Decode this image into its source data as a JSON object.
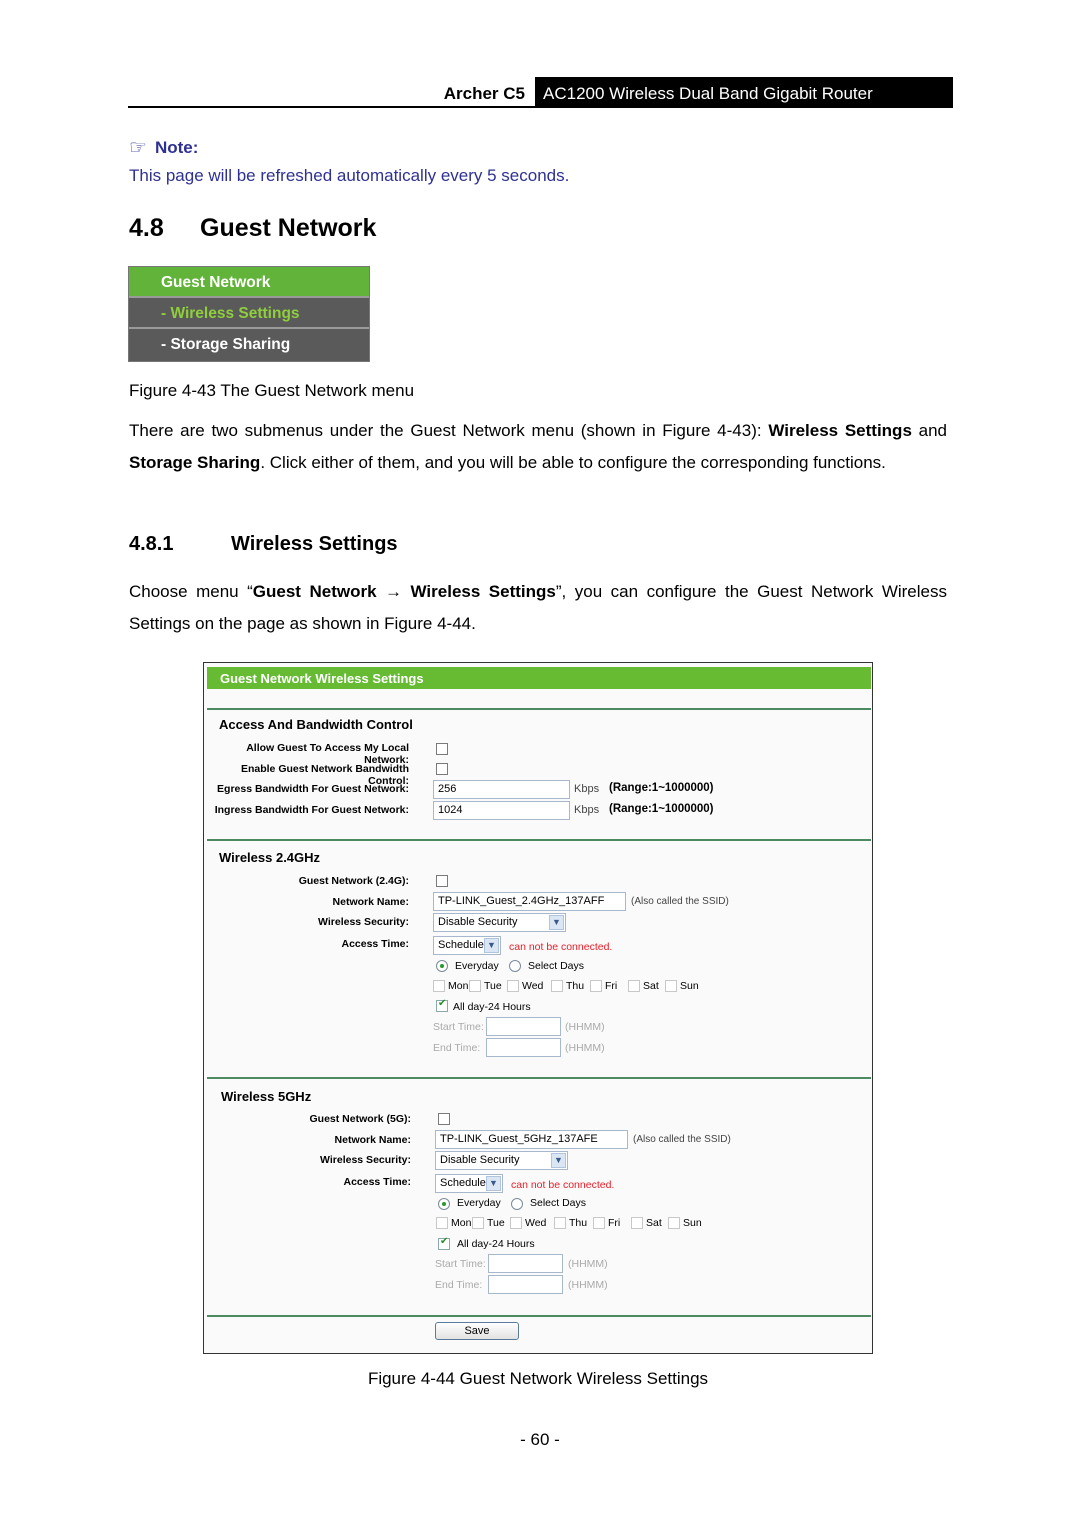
{
  "header": {
    "model": "Archer C5",
    "product": "AC1200 Wireless Dual Band Gigabit Router"
  },
  "note": {
    "icon": "pointing-hand-icon",
    "label": "Note:",
    "text": "This page will be refreshed automatically every 5 seconds."
  },
  "section": {
    "number": "4.8",
    "title": "Guest Network"
  },
  "menu": {
    "items": [
      {
        "label": "Guest Network"
      },
      {
        "label": "- Wireless Settings"
      },
      {
        "label": "- Storage Sharing"
      }
    ],
    "caption": "Figure 4-43 The Guest Network menu"
  },
  "intro": {
    "p1": "There are two submenus under the Guest Network menu (shown in Figure 4-43): ",
    "b1": "Wireless Settings",
    "p2": " and ",
    "b2": "Storage Sharing",
    "p3": ". Click either of them, and you will be able to configure the corresponding functions."
  },
  "subsection": {
    "number": "4.8.1",
    "title": "Wireless Settings"
  },
  "choose": {
    "p1": "Choose menu “",
    "b1": "Guest Network",
    "arrow": " → ",
    "b2": "Wireless Settings",
    "p2": "”, you can configure the Guest Network Wireless Settings on the page as shown in Figure 4-44."
  },
  "figure": {
    "title": "Guest Network Wireless Settings",
    "access": {
      "title": "Access And Bandwidth Control",
      "allow_label": "Allow Guest To Access My Local Network:",
      "enable_bw_label": "Enable Guest Network Bandwidth Control:",
      "egress_label": "Egress Bandwidth For Guest Network:",
      "egress_value": "256",
      "ingress_label": "Ingress Bandwidth For Guest Network:",
      "ingress_value": "1024",
      "unit": "Kbps",
      "range": "(Range:1~1000000)"
    },
    "w24": {
      "title": "Wireless 2.4GHz",
      "guest_label": "Guest Network (2.4G):",
      "name_label": "Network Name:",
      "name_value": "TP-LINK_Guest_2.4GHz_137AFF",
      "ssid_hint": "(Also called the SSID)",
      "security_label": "Wireless Security:",
      "security_value": "Disable Security",
      "access_label": "Access Time:",
      "access_value": "Schedule",
      "warning": "can not be connected.",
      "everyday": "Everyday",
      "select_days": "Select Days",
      "days": [
        "Mon",
        "Tue",
        "Wed",
        "Thu",
        "Fri",
        "Sat",
        "Sun"
      ],
      "allday": "All day-24 Hours",
      "start_label": "Start Time:",
      "end_label": "End Time:",
      "time_hint": "(HHMM)"
    },
    "w5": {
      "title": "Wireless 5GHz",
      "guest_label": "Guest Network (5G):",
      "name_label": "Network Name:",
      "name_value": "TP-LINK_Guest_5GHz_137AFE",
      "ssid_hint": "(Also called the SSID)",
      "security_label": "Wireless Security:",
      "security_value": "Disable Security",
      "access_label": "Access Time:",
      "access_value": "Schedule",
      "warning": "can not be connected.",
      "everyday": "Everyday",
      "select_days": "Select Days",
      "days": [
        "Mon",
        "Tue",
        "Wed",
        "Thu",
        "Fri",
        "Sat",
        "Sun"
      ],
      "allday": "All day-24 Hours",
      "start_label": "Start Time:",
      "end_label": "End Time:",
      "time_hint": "(HHMM)"
    },
    "save_label": "Save",
    "caption": "Figure 4-44 Guest Network Wireless Settings"
  },
  "page_number": "- 60 -",
  "colors": {
    "note_blue": "#2e3192",
    "menu_green": "#62b33a",
    "menu_active": "#8fcf3c",
    "title_green": "#66bb33",
    "warning_red": "#e8202a"
  }
}
